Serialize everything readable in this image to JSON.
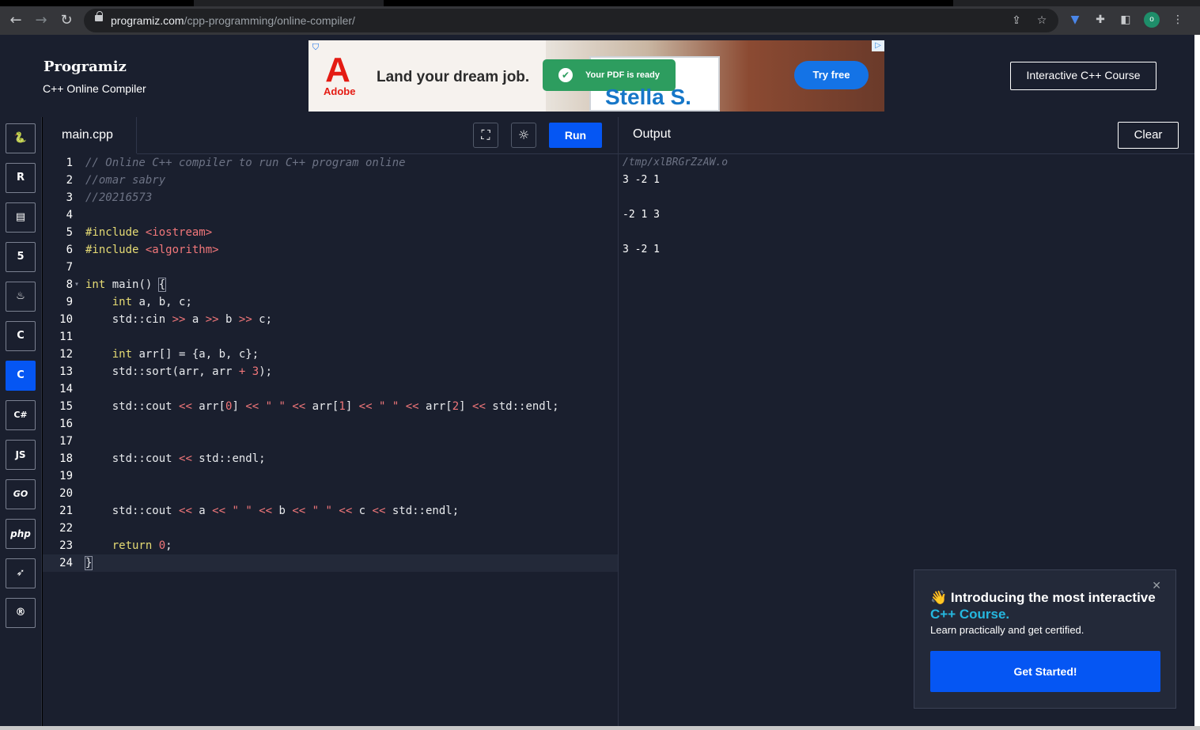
{
  "browser": {
    "url_domain": "programiz.com",
    "url_path": "/cpp-programming/online-compiler/",
    "profile_initial": "o"
  },
  "header": {
    "logo": "Programiz",
    "subtitle": "C++ Online Compiler",
    "course_button": "Interactive C++ Course"
  },
  "ad": {
    "brand": "Adobe",
    "headline": "Land your dream job.",
    "toast": "Your PDF is ready",
    "name": "Stella S.",
    "cta": "Try free"
  },
  "sidebar": {
    "languages": [
      {
        "name": "python",
        "glyph": "🐍"
      },
      {
        "name": "r",
        "glyph": "R"
      },
      {
        "name": "sql",
        "glyph": "▤"
      },
      {
        "name": "html",
        "glyph": "5"
      },
      {
        "name": "java",
        "glyph": "♨"
      },
      {
        "name": "c",
        "glyph": "C"
      },
      {
        "name": "cpp",
        "glyph": "C"
      },
      {
        "name": "csharp",
        "glyph": "C#"
      },
      {
        "name": "javascript",
        "glyph": "JS"
      },
      {
        "name": "go",
        "glyph": "GO"
      },
      {
        "name": "php",
        "glyph": "php"
      },
      {
        "name": "swift",
        "glyph": "➶"
      },
      {
        "name": "rust",
        "glyph": "®"
      }
    ],
    "active_index": 6
  },
  "editor": {
    "filename": "main.cpp",
    "run_label": "Run",
    "lines": [
      "1",
      "2",
      "3",
      "4",
      "5",
      "6",
      "7",
      "8",
      "9",
      "10",
      "11",
      "12",
      "13",
      "14",
      "15",
      "16",
      "17",
      "18",
      "19",
      "20",
      "21",
      "22",
      "23",
      "24"
    ]
  },
  "output": {
    "title": "Output",
    "clear_label": "Clear",
    "path": "/tmp/xlBRGrZzAW.o",
    "lines": [
      "3 -2 1",
      "",
      "-2 1 3",
      "",
      "3 -2 1"
    ]
  },
  "promo": {
    "title_start": "👋 Introducing the most interactive ",
    "title_accent": "C++ Course.",
    "subtitle": "Learn practically and get certified.",
    "cta": "Get Started!"
  }
}
